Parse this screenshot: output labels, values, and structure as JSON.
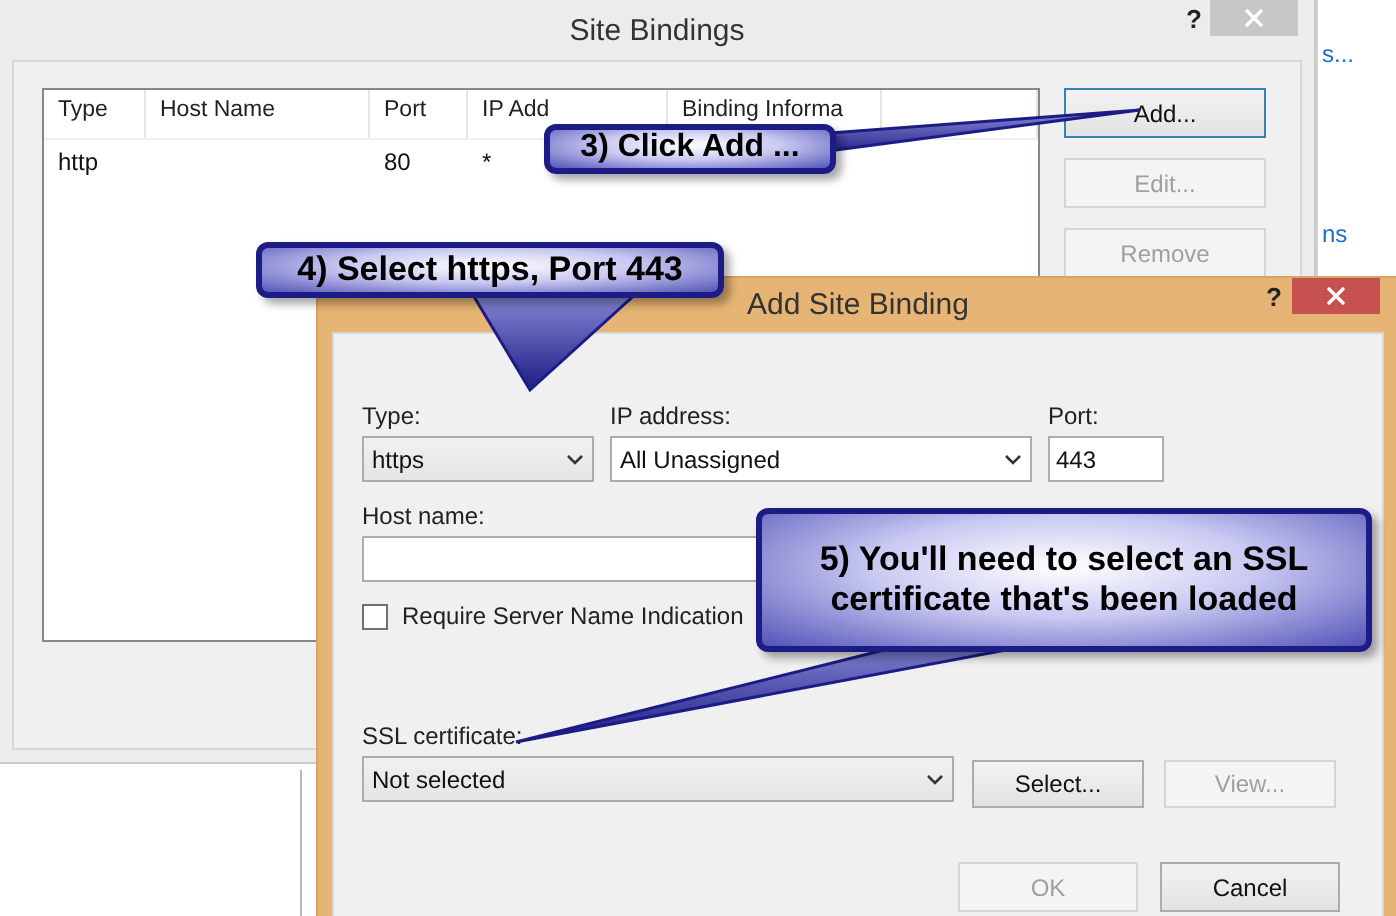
{
  "background_window": {
    "links": [
      "s...",
      "ns"
    ]
  },
  "site_bindings": {
    "title": "Site Bindings",
    "help": "?",
    "columns": [
      "Type",
      "Host Name",
      "Port",
      "IP Add",
      "Binding Informa"
    ],
    "rows": [
      {
        "type": "http",
        "port": "80",
        "ip_address": "*"
      }
    ],
    "buttons": [
      {
        "label": "Add...",
        "disabled": false,
        "focused": true
      },
      {
        "label": "Edit...",
        "disabled": true,
        "focused": false
      },
      {
        "label": "Remove",
        "disabled": true,
        "focused": false
      }
    ]
  },
  "add_site_binding": {
    "title": "Add Site Binding",
    "help": "?",
    "type": {
      "label": "Type:",
      "value": "https"
    },
    "ip_address": {
      "label": "IP address:",
      "value": "All Unassigned"
    },
    "port": {
      "label": "Port:",
      "value": "443"
    },
    "host_name": {
      "label": "Host name:"
    },
    "sni": {
      "label": "Require Server Name Indication",
      "checked": false
    },
    "ssl_certificate": {
      "label": "SSL certificate:",
      "value": "Not selected"
    },
    "cert_buttons": [
      {
        "label": "Select...",
        "disabled": false
      },
      {
        "label": "View...",
        "disabled": true
      }
    ],
    "buttons": [
      {
        "label": "OK",
        "disabled": true
      },
      {
        "label": "Cancel",
        "disabled": false
      }
    ]
  },
  "callouts": [
    {
      "text": "3) Click Add ..."
    },
    {
      "text": "4) Select https, Port 443"
    },
    {
      "text": "5) You'll need to select an SSL certificate that's been loaded"
    }
  ]
}
